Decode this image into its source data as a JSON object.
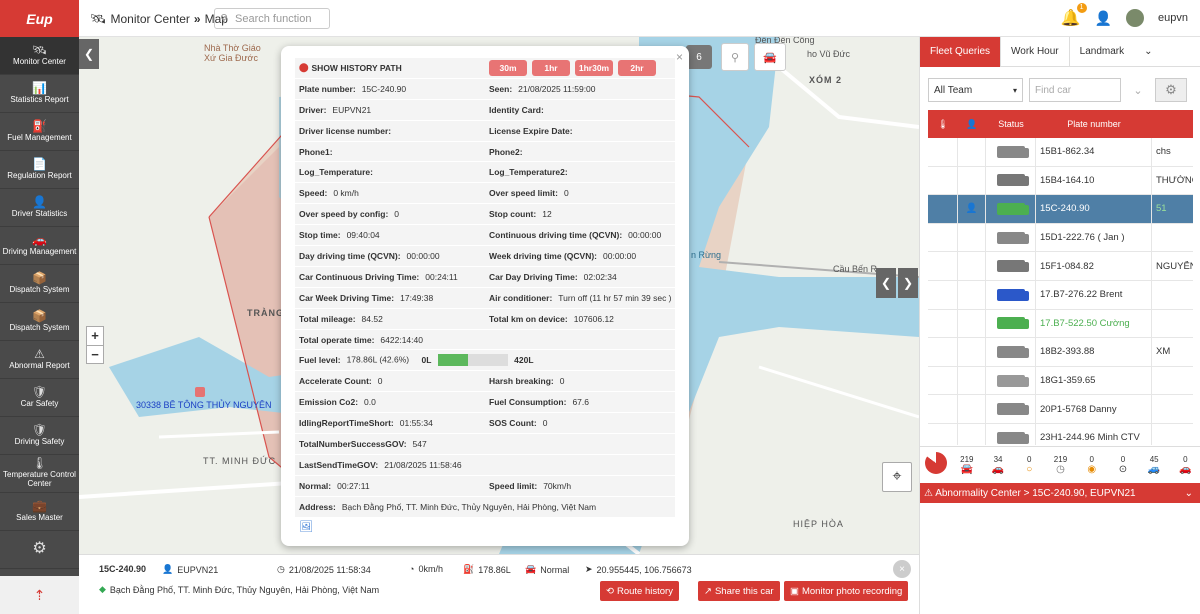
{
  "app": {
    "logo": "Eup",
    "breadcrumb": [
      "Monitor Center",
      "»",
      "Map"
    ],
    "search_placeholder": "Search function",
    "notifications": "1",
    "username": "eupvn"
  },
  "colors": {
    "accent": "#d63a34",
    "selected_row": "#4f7fa6",
    "fuel_fill": "#5cb85c"
  },
  "sidebar": [
    {
      "label": "Monitor Center",
      "icon": "satellite-icon"
    },
    {
      "label": "Statistics Report",
      "icon": "chart-icon"
    },
    {
      "label": "Fuel Management",
      "icon": "fuel-icon"
    },
    {
      "label": "Regulation Report",
      "icon": "report-icon"
    },
    {
      "label": "Driver Statistics",
      "icon": "driver-icon"
    },
    {
      "label": "Driving Management",
      "icon": "steering-icon"
    },
    {
      "label": "Dispatch System",
      "icon": "dispatch-icon"
    },
    {
      "label": "Dispatch System",
      "icon": "dispatch-icon"
    },
    {
      "label": "Abnormal Report",
      "icon": "warning-icon"
    },
    {
      "label": "Car Safety",
      "icon": "shield-icon"
    },
    {
      "label": "Driving Safety",
      "icon": "shield-icon"
    },
    {
      "label": "Temperature Control Center",
      "icon": "thermometer-icon"
    },
    {
      "label": "Sales Master",
      "icon": "sales-icon"
    }
  ],
  "map": {
    "labels": [
      "Nhà Thờ Giáo Xứ Gia Đước",
      "XÓM 2",
      "TRÀNG",
      "TT. MINH ĐỨC",
      "HIỆP HÒA",
      "Cầu Bến R",
      "n Rừng",
      "Đền Đến Công",
      "ho Vũ Đức"
    ],
    "poi": "30338 BÊ TÔNG THỦY NGUYÊN",
    "counter": "6"
  },
  "popup": {
    "title": "SHOW HISTORY PATH",
    "history_buttons": [
      "30m",
      "1hr",
      "1hr30m",
      "2hr"
    ],
    "rows": [
      [
        {
          "k": "Plate number:",
          "v": "15C-240.90"
        },
        {
          "k": "Seen:",
          "v": "21/08/2025 11:59:00"
        }
      ],
      [
        {
          "k": "Driver:",
          "v": "EUPVN21"
        },
        {
          "k": "Identity Card:",
          "v": ""
        }
      ],
      [
        {
          "k": "Driver license number:",
          "v": ""
        },
        {
          "k": "License Expire Date:",
          "v": ""
        }
      ],
      [
        {
          "k": "Phone1:",
          "v": ""
        },
        {
          "k": "Phone2:",
          "v": ""
        }
      ],
      [
        {
          "k": "Log_Temperature:",
          "v": ""
        },
        {
          "k": "Log_Temperature2:",
          "v": ""
        }
      ],
      [
        {
          "k": "Speed:",
          "v": "0 km/h"
        },
        {
          "k": "Over speed limit:",
          "v": "0"
        }
      ],
      [
        {
          "k": "Over speed by config:",
          "v": "0"
        },
        {
          "k": "Stop count:",
          "v": "12"
        }
      ],
      [
        {
          "k": "Stop time:",
          "v": "09:40:04"
        },
        {
          "k": "Continuous driving time (QCVN):",
          "v": "00:00:00"
        }
      ],
      [
        {
          "k": "Day driving time (QCVN):",
          "v": "00:00:00"
        },
        {
          "k": "Week driving time (QCVN):",
          "v": "00:00:00"
        }
      ],
      [
        {
          "k": "Car Continuous Driving Time:",
          "v": "00:24:11"
        },
        {
          "k": "Car Day Driving Time:",
          "v": "02:02:34"
        }
      ],
      [
        {
          "k": "Car Week Driving Time:",
          "v": "17:49:38"
        },
        {
          "k": "Air conditioner:",
          "v": "Turn off (11 hr 57 min 39 sec )"
        }
      ],
      [
        {
          "k": "Total mileage:",
          "v": "84.52"
        },
        {
          "k": "Total km on device:",
          "v": "107606.12"
        }
      ],
      [
        {
          "k": "Total operate time:",
          "v": "6422:14:40"
        }
      ]
    ],
    "fuel": {
      "k": "Fuel level:",
      "v": "178.86L (42.6%)",
      "min": "0L",
      "max": "420L",
      "fraction": 0.426
    },
    "rows2": [
      [
        {
          "k": "Accelerate Count:",
          "v": "0"
        },
        {
          "k": "Harsh breaking:",
          "v": "0"
        }
      ],
      [
        {
          "k": "Emission Co2:",
          "v": "0.0"
        },
        {
          "k": "Fuel Consumption:",
          "v": "67.6"
        }
      ],
      [
        {
          "k": "IdlingReportTimeShort:",
          "v": "01:55:34"
        },
        {
          "k": "SOS Count:",
          "v": "0"
        }
      ],
      [
        {
          "k": "TotalNumberSuccessGOV:",
          "v": "547"
        }
      ],
      [
        {
          "k": "LastSendTimeGOV:",
          "v": "21/08/2025 11:58:46"
        }
      ],
      [
        {
          "k": "Normal:",
          "v": "00:27:11"
        },
        {
          "k": "Speed limit:",
          "v": "70km/h"
        }
      ],
      [
        {
          "k": "Address:",
          "v": "Bạch Đằng Phố, TT. Minh Đức, Thủy Nguyên, Hải Phòng, Việt Nam"
        }
      ]
    ]
  },
  "bottom": {
    "plate": "15C-240.90",
    "driver": "EUPVN21",
    "time": "21/08/2025 11:58:34",
    "speed": "0km/h",
    "fuel": "178.86L",
    "status": "Normal",
    "coords": "20.955445, 106.756673",
    "address": "Bạch Đằng Phố, TT. Minh Đức, Thủy Nguyên, Hải Phòng, Việt Nam",
    "buttons": [
      "Route history",
      "Share this car",
      "Monitor photo recording"
    ]
  },
  "right": {
    "tabs": [
      "Fleet Queries",
      "Work Hour",
      "Landmark"
    ],
    "team": "All Team",
    "find_placeholder": "Find car",
    "headers": [
      "Status",
      "Plate number"
    ],
    "rows": [
      {
        "plate": "15B1-862.34",
        "extra": "chs",
        "color": "#888"
      },
      {
        "plate": "15B4-164.10",
        "extra": "THƯỜNG",
        "color": "#777"
      },
      {
        "plate": "15C-240.90",
        "extra": "51",
        "color": "#4caf50",
        "selected": true
      },
      {
        "plate": "15D1-222.76 ( Jan )",
        "extra": "",
        "color": "#888"
      },
      {
        "plate": "15F1-084.82",
        "extra": "NGUYỄN",
        "color": "#777"
      },
      {
        "plate": "17.B7-276.22 Brent",
        "extra": "",
        "color": "#2b58c9"
      },
      {
        "plate": "17.B7-522.50 Cường",
        "extra": "",
        "color": "#4caf50",
        "green": true
      },
      {
        "plate": "18B2-393.88",
        "extra": "XM",
        "color": "#888"
      },
      {
        "plate": "18G1-359.65",
        "extra": "",
        "color": "#999"
      },
      {
        "plate": "20P1-5768 Danny",
        "extra": "",
        "color": "#888"
      },
      {
        "plate": "23H1-244.96 Minh CTV",
        "extra": "",
        "color": "#888"
      }
    ],
    "stats": [
      "219",
      "34",
      "0",
      "219",
      "0",
      "0",
      "45",
      "0"
    ],
    "abnormality": "Abnormality Center > 15C-240.90, EUPVN21"
  }
}
